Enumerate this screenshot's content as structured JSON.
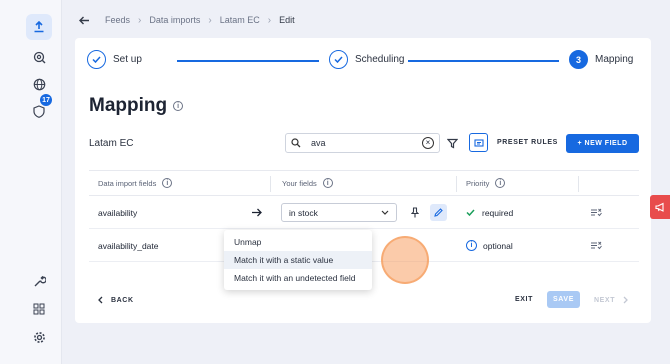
{
  "breadcrumb": [
    "Feeds",
    "Data imports",
    "Latam EC",
    "Edit"
  ],
  "steps": [
    {
      "label": "Set up",
      "state": "done"
    },
    {
      "label": "Scheduling",
      "state": "done"
    },
    {
      "label": "Mapping",
      "number": "3",
      "state": "current"
    }
  ],
  "page_title": "Mapping",
  "feed_name": "Latam EC",
  "search": {
    "value": "ava"
  },
  "preset_rules_label": "PRESET RULES",
  "new_field_label": "+ NEW FIELD",
  "table": {
    "headers": [
      "Data import fields",
      "Your fields",
      "Priority"
    ],
    "rows": [
      {
        "field": "availability",
        "your_field": "in stock",
        "priority": "required"
      },
      {
        "field": "availability_date",
        "your_field": "- u",
        "priority": "optional"
      }
    ]
  },
  "menu": {
    "items": [
      "Unmap",
      "Match it with a static value",
      "Match it with an undetected field"
    ]
  },
  "footer": {
    "back": "BACK",
    "exit": "EXIT",
    "save": "SAVE",
    "next": "NEXT"
  },
  "sidebar": {
    "badge_count": "17"
  },
  "colors": {
    "accent": "#1769e0",
    "feedback": "#e84c4c"
  }
}
